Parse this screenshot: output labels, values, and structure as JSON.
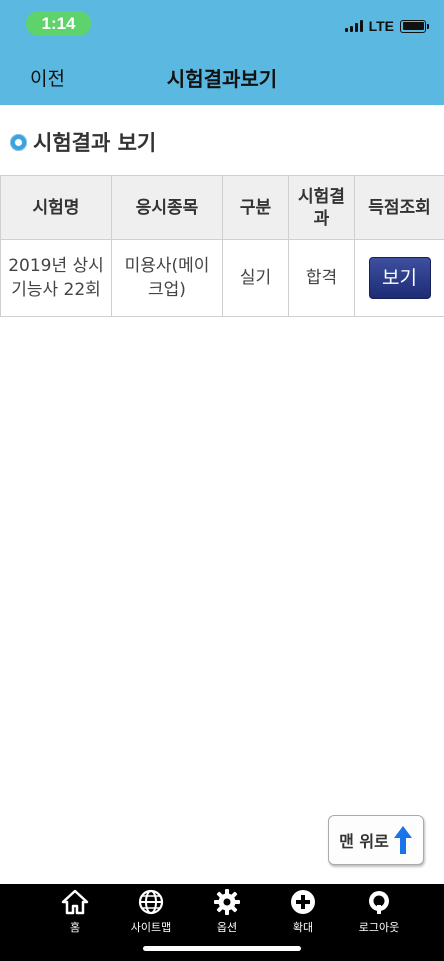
{
  "status_bar": {
    "time": "1:14",
    "network": "LTE"
  },
  "header": {
    "back_label": "이전",
    "title": "시험결과보기"
  },
  "section": {
    "title": "시험결과 보기"
  },
  "table": {
    "headers": [
      "시험명",
      "응시종목",
      "구분",
      "시험결\n과",
      "득점조회"
    ],
    "rows": [
      {
        "exam_name": "2019년 상시\n기능사 22회",
        "subject": "미용사(메이\n크업)",
        "type": "실기",
        "result": "합격",
        "score_button": "보기"
      }
    ]
  },
  "scroll_top": {
    "label": "맨 위로"
  },
  "bottom_nav": {
    "items": [
      {
        "label": "홈",
        "icon": "home-icon"
      },
      {
        "label": "사이트맵",
        "icon": "globe-icon"
      },
      {
        "label": "옵션",
        "icon": "gear-icon"
      },
      {
        "label": "확대",
        "icon": "plus-circle-icon"
      },
      {
        "label": "로그아웃",
        "icon": "power-icon"
      }
    ]
  },
  "colors": {
    "header_bg": "#5bb8e0",
    "button": "#1d2c75",
    "arrow": "#1a73e8"
  }
}
